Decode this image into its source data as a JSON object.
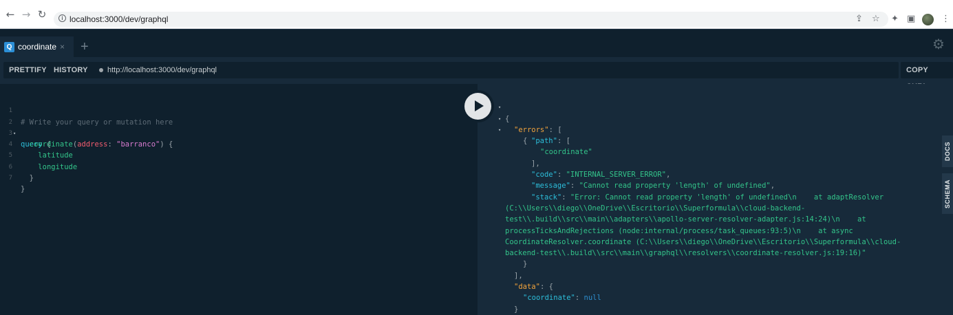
{
  "browser": {
    "url": "localhost:3000/dev/graphql",
    "icons": [
      "back-icon",
      "forward-icon",
      "reload-icon",
      "site-info-icon",
      "share-icon",
      "star-icon",
      "extensions-icon",
      "sidepanel-icon",
      "profile-avatar",
      "more-icon"
    ]
  },
  "tabs": {
    "active_badge": "Q",
    "active_title": "coordinate",
    "close_glyph": "×",
    "add_glyph": "+"
  },
  "toolbar": {
    "prettify_label": "PRETTIFY",
    "history_label": "HISTORY",
    "endpoint": "http://localhost:3000/dev/graphql",
    "copy_curl_label": "COPY CURL"
  },
  "query_lines": [
    {
      "num": "1",
      "text": "# Write your query or mutation here"
    },
    {
      "num": "2",
      "text": "query {"
    },
    {
      "num": "3",
      "text": "  coordinate(address: \"barranco\") {"
    },
    {
      "num": "4",
      "text": "    latitude"
    },
    {
      "num": "5",
      "text": "    longitude"
    },
    {
      "num": "6",
      "text": "  }"
    },
    {
      "num": "7",
      "text": "}"
    }
  ],
  "query": {
    "comment": "# Write your query or mutation here",
    "keyword": "query",
    "field": "coordinate",
    "arg_name": "address",
    "arg_value": "\"barranco\"",
    "sub_fields": [
      "latitude",
      "longitude"
    ]
  },
  "result": {
    "errors_key": "\"errors\"",
    "path_key": "\"path\"",
    "path_value": "\"coordinate\"",
    "code_key": "\"code\"",
    "code_value": "\"INTERNAL_SERVER_ERROR\"",
    "message_key": "\"message\"",
    "message_value": "\"Cannot read property 'length' of undefined\"",
    "stack_key": "\"stack\"",
    "stack_lines": [
      "\"Error: Cannot read property 'length' of undefined\\n    at adaptResolver",
      "(C:\\\\Users\\\\diego\\\\OneDrive\\\\Escritorio\\\\Superformula\\\\cloud-backend-",
      "test\\\\.build\\\\src\\\\main\\\\adapters\\\\apollo-server-resolver-adapter.js:14:24)\\n    at",
      "processTicksAndRejections (node:internal/process/task_queues:93:5)\\n    at async",
      "CoordinateResolver.coordinate (C:\\\\Users\\\\diego\\\\OneDrive\\\\Escritorio\\\\Superformula\\\\cloud-",
      "backend-test\\\\.build\\\\src\\\\main\\\\graphql\\\\resolvers\\\\coordinate-resolver.js:19:16)\""
    ],
    "data_key": "\"data\"",
    "coordinate_key": "\"coordinate\"",
    "coordinate_value": "null"
  },
  "side_tabs": {
    "docs": "DOCS",
    "schema": "SCHEMA"
  },
  "colors": {
    "editor_bg": "#0f202d",
    "result_bg": "#172a3a",
    "keyword": "#2dbeda",
    "field": "#33c48a",
    "argument": "#f25c6f",
    "string": "#d97bd0",
    "null": "#2e8fcf"
  }
}
